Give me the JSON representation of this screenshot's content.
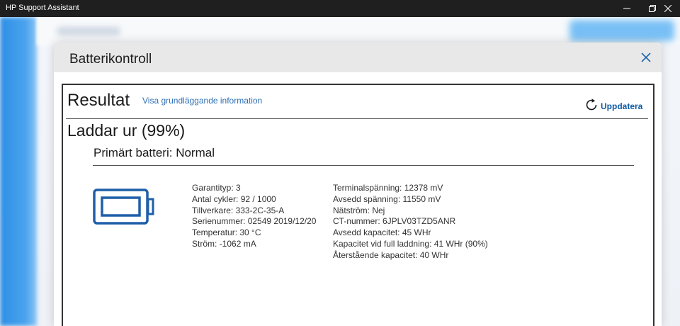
{
  "window": {
    "title": "HP Support Assistant"
  },
  "dialog": {
    "title": "Batterikontroll"
  },
  "result": {
    "heading": "Resultat",
    "info_link": "Visa grundläggande information",
    "refresh_label": "Uppdatera",
    "status": "Laddar ur (99%)",
    "battery_heading": "Primärt batteri: Normal"
  },
  "details_left": [
    "Garantityp: 3",
    "Antal cykler: 92 / 1000",
    "Tillverkare: 333-2C-35-A",
    "Serienummer: 02549 2019/12/20",
    "Temperatur: 30 °C",
    "Ström: -1062 mA"
  ],
  "details_right": [
    "Terminalspänning: 12378 mV",
    "Avsedd spänning: 11550 mV",
    "Nätström: Nej",
    "CT-nummer: 6JPLV03TZD5ANR",
    "Avsedd kapacitet: 45 WHr",
    "Kapacitet vid full laddning: 41 WHr (90%)",
    "Återstående kapacitet: 40 WHr"
  ],
  "icons": {
    "minimize": "minimize-icon",
    "maximize": "restore-icon",
    "close": "close-icon",
    "dialog_close": "close-icon",
    "refresh": "refresh-icon",
    "battery": "battery-icon"
  },
  "colors": {
    "accent": "#0c5aa6",
    "link": "#2d6fb5",
    "battery_icon": "#1f5fa8",
    "titlebar": "#1f1f1f"
  }
}
